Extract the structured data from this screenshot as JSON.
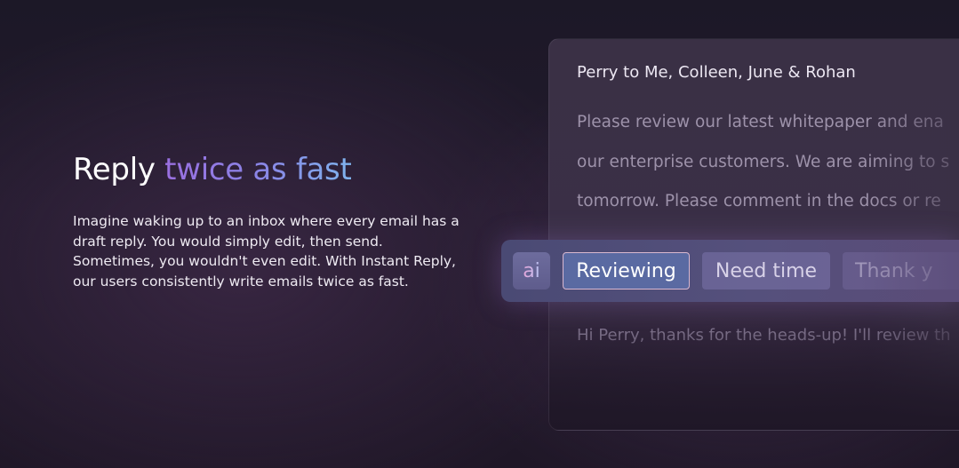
{
  "hero": {
    "title_plain": "Reply ",
    "title_highlight": "twice as fast",
    "body": "Imagine waking up to an inbox where every email has a draft reply. You would simply edit, then send. Sometimes, you wouldn't even edit.  With Instant Reply, our users consistently write emails twice as fast."
  },
  "email": {
    "from": "Perry to Me, Colleen, June & Rohan",
    "lines": [
      "Please review our latest whitepaper and ena",
      "our enterprise customers. We are aiming to s",
      "tomorrow.  Please comment in the docs or re"
    ],
    "draft_reply": "Hi Perry, thanks for the heads-up!  I'll review th"
  },
  "suggestions": {
    "badge": "ai",
    "chips": [
      "Reviewing",
      "Need time",
      "Thank y"
    ]
  },
  "colors": {
    "highlight_start": "#9a6fe0",
    "highlight_end": "#7fb2ec",
    "selected_chip": "#5a6aa2"
  }
}
